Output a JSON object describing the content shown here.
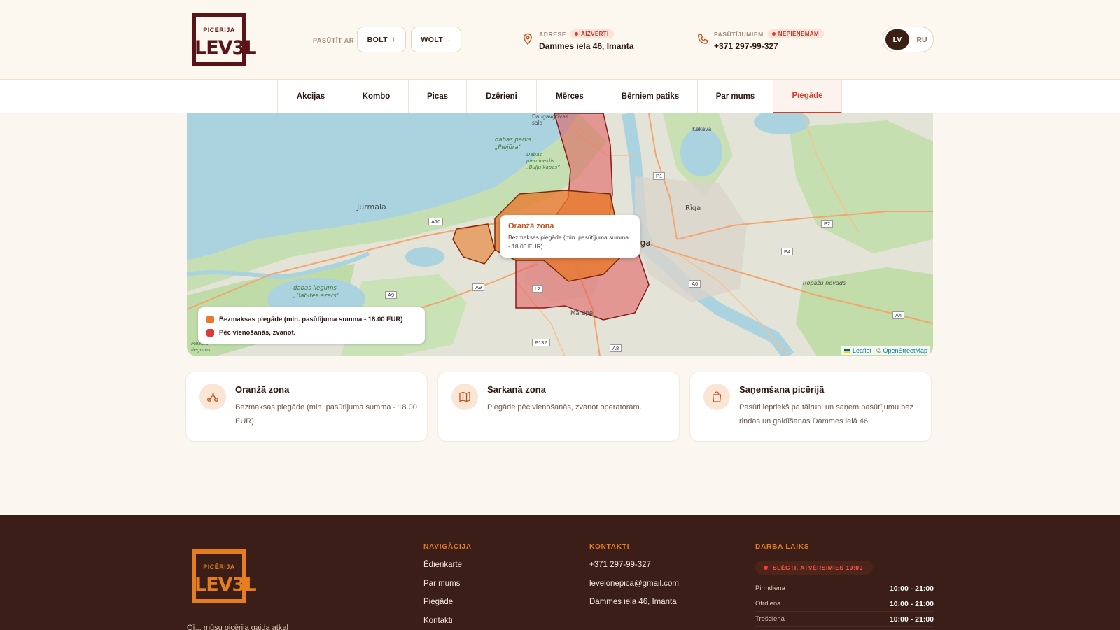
{
  "header": {
    "logo_small": "PICĒRIJA",
    "logo_big": "LEV3L",
    "order_label": "PASŪTĪT AR",
    "bolt": "BOLT",
    "wolt": "WOLT",
    "arrow": "↓",
    "address_label": "ADRESE",
    "address_badge": "AIZVĒRTI",
    "address": "Dammes iela 46, Imanta",
    "phone_label": "PASŪTĪJUMIEM",
    "phone_badge": "NEPIEŅEMAM",
    "phone": "+371 297-99-327",
    "lang_lv": "LV",
    "lang_ru": "RU"
  },
  "nav": [
    "Akcijas",
    "Kombo",
    "Picas",
    "Dzērieni",
    "Mērces",
    "Bērniem patiks",
    "Par mums",
    "Piegāde"
  ],
  "map": {
    "labels": {
      "jurmala": "Jūrmala",
      "riga": "Rīga",
      "riga_right": "Rīga",
      "daugavgriva": "Daugavgrīvas sala",
      "piejura": "dabas parks „Piejūra”",
      "bullu": "Dabas piemineklis „Buļļu kāpas”",
      "babites": "dabas liegums „Babītes ezers”",
      "marupe": "Mārupe",
      "ropazu": "Ropažu novads",
      "kekava": "Ķekava",
      "mezgli": "Mežala liegums"
    },
    "roads": [
      "A10",
      "A9",
      "A9",
      "L2",
      "P132",
      "A8",
      "A6",
      "P1",
      "P2",
      "P4",
      "A4"
    ],
    "popup_title": "Oranžā zona",
    "popup_desc": "Bezmaksas piegāde (min. pasūtījuma summa - 18.00 EUR)",
    "legend_orange": "Bezmaksas piegāde (min. pasūtījuma summa - 18.00 EUR)",
    "legend_red": "Pēc vienošanās, zvanot.",
    "attrib_leaflet": "Leaflet",
    "attrib_sep": " | © ",
    "attrib_osm": "OpenStreetMap"
  },
  "cards": [
    {
      "title": "Oranžā zona",
      "desc": "Bezmaksas piegāde (min. pasūtījuma summa - 18.00 EUR).",
      "icon": "scooter-icon"
    },
    {
      "title": "Sarkanā zona",
      "desc": "Piegāde pēc vienošanās, zvanot operatoram.",
      "icon": "map-icon"
    },
    {
      "title": "Saņemšana picērijā",
      "desc": "Pasūti iepriekš pa tālruni un saņem pasūtījumu bez rindas un gaidīšanas Dammes ielā 46.",
      "icon": "bag-icon"
    }
  ],
  "footer": {
    "nav_title": "NAVIGĀCIJA",
    "nav_links": [
      "Ēdienkarte",
      "Par mums",
      "Piegāde",
      "Kontakti"
    ],
    "contacts_title": "KONTAKTI",
    "contacts": [
      "+371 297-99-327",
      "levelonepica@gmail.com",
      "Dammes iela 46, Imanta"
    ],
    "hours_title": "DARBA LAIKS",
    "status": "SLĒGTI, ATVĒRSIMIES 10:00",
    "hours": [
      {
        "day": "Pirmdiena",
        "time": "10:00 - 21:00"
      },
      {
        "day": "Otrdiena",
        "time": "10:00 - 21:00"
      },
      {
        "day": "Trešdiena",
        "time": "10:00 - 21:00"
      }
    ],
    "tagline": "Oī... mūsu picērija gaida atkal"
  },
  "colors": {
    "orange_zone": "#e8792a",
    "red_zone": "#e05a5a",
    "accent": "#d63a2b",
    "brand": "#5a1418"
  }
}
